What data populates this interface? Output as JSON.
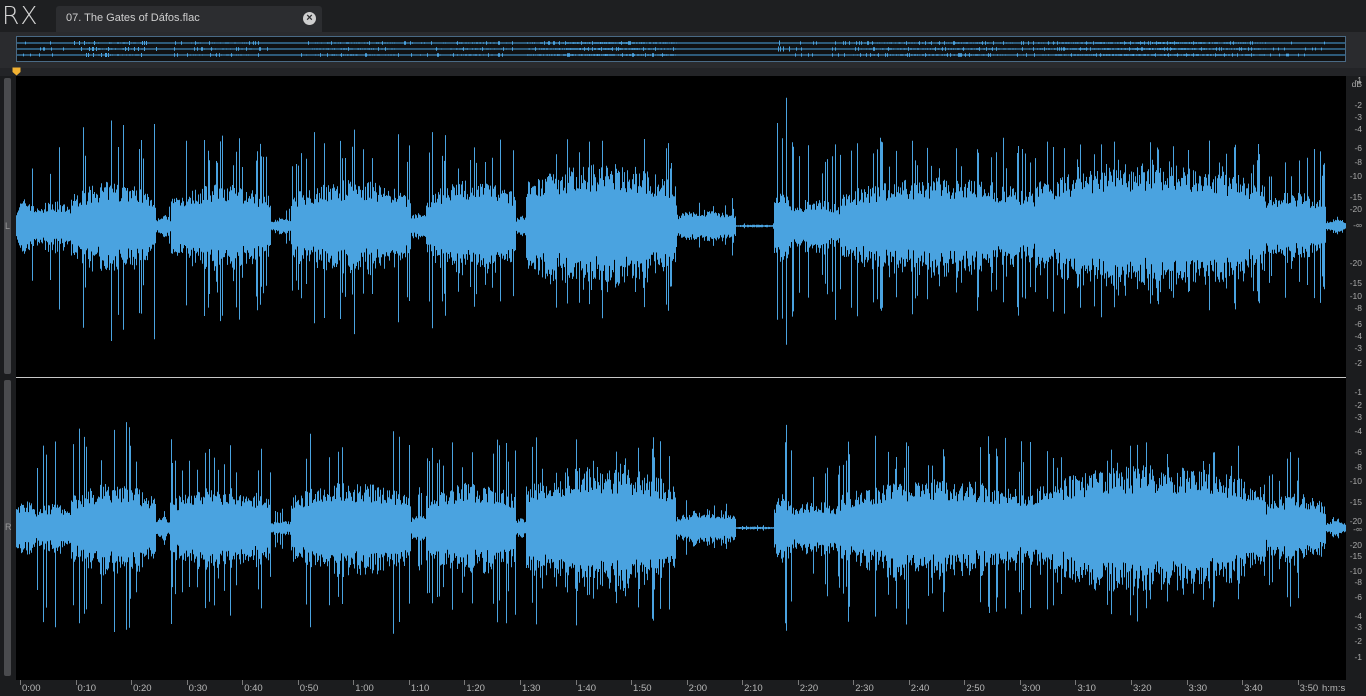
{
  "app": {
    "logo": "RX"
  },
  "tab": {
    "title": "07. The Gates of Dáfos.flac",
    "close_icon": "close-icon"
  },
  "channels": {
    "left_label": "L",
    "right_label": "R"
  },
  "waveform_color": "#4aa3e0",
  "db_scale": {
    "unit": "dB",
    "left_ticks": [
      "-2",
      "-3",
      "-4",
      "-6",
      "-8",
      "-10",
      "-15",
      "-20",
      "-∞",
      "-20",
      "-15",
      "-10",
      "-8",
      "-6",
      "-4",
      "-3",
      "-2",
      "-1"
    ],
    "right_ticks": [
      "-1",
      "-2",
      "-3",
      "-4",
      "-6",
      "-8",
      "-10",
      "-15",
      "-20",
      "-∞",
      "-20",
      "-15",
      "-10",
      "-8",
      "-6",
      "-4",
      "-3",
      "-2",
      "-1"
    ]
  },
  "timeline": {
    "labels": [
      "0:00",
      "0:10",
      "0:20",
      "0:30",
      "0:40",
      "0:50",
      "1:00",
      "1:10",
      "1:20",
      "1:30",
      "1:40",
      "1:50",
      "2:00",
      "2:10",
      "2:20",
      "2:30",
      "2:40",
      "2:50",
      "3:00",
      "3:10",
      "3:20",
      "3:30",
      "3:40",
      "3:50"
    ],
    "unit": "h:m:s"
  },
  "playhead_icon": "playhead-marker-icon"
}
